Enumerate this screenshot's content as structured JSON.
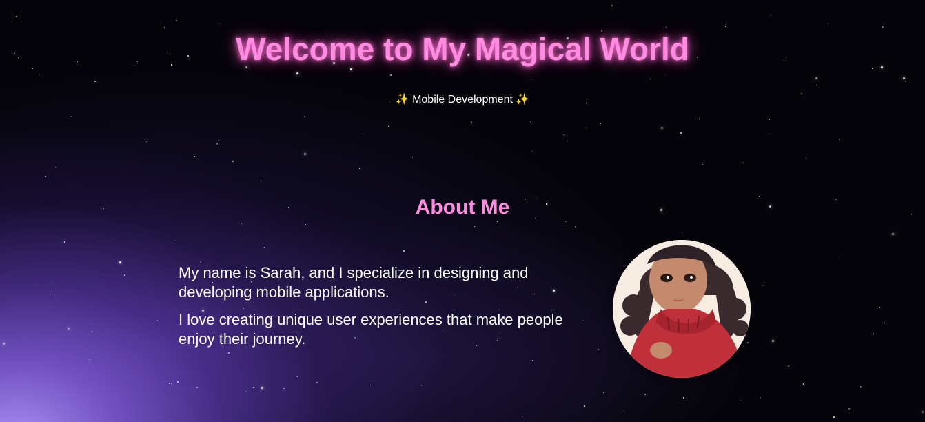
{
  "header": {
    "title": "Welcome to My Magical World",
    "subtitle_sparkle_left": "✨",
    "subtitle": "Mobile Development",
    "subtitle_sparkle_right": "✨"
  },
  "about": {
    "heading": "About Me",
    "paragraphs": [
      "My name is Sarah, and I specialize in designing and developing mobile applications.",
      "I love creating unique user experiences that make people enjoy their journey."
    ],
    "avatar_icon": "avatar-illustration"
  },
  "colors": {
    "accent_pink": "#ff8ce0",
    "text": "#ffffff",
    "background": "#05040a",
    "nebula_purple": "#9b6cf0"
  }
}
